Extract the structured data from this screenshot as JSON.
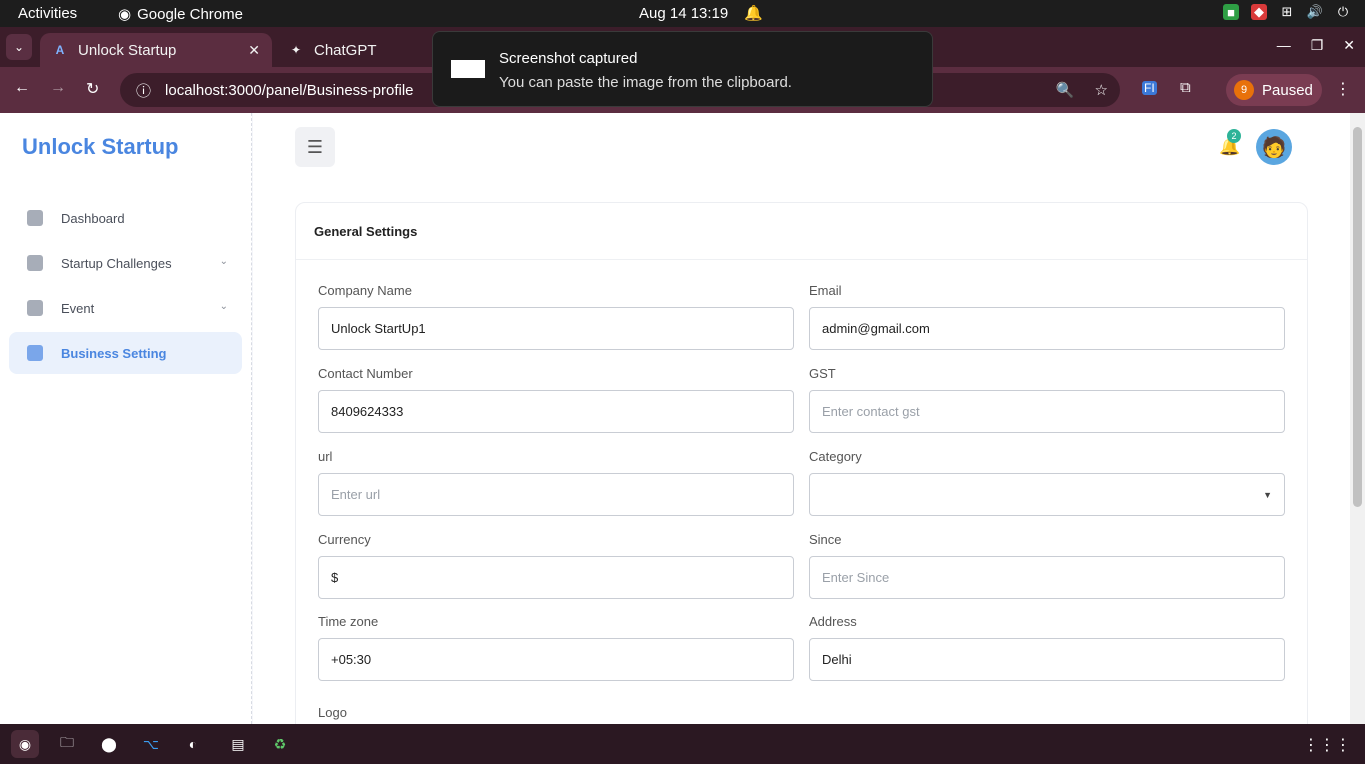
{
  "os": {
    "activities": "Activities",
    "app_name": "Google Chrome",
    "clock": "Aug 14  13:19"
  },
  "browser": {
    "tabs": [
      {
        "label": "Unlock Startup",
        "favicon": "A"
      },
      {
        "label": "ChatGPT",
        "favicon": "✦"
      }
    ],
    "url": "localhost:3000/panel/Business-profile",
    "profile_badge": "9",
    "profile_label": "Paused",
    "ext_label": "FI"
  },
  "toast": {
    "title": "Screenshot captured",
    "message": "You can paste the image from the clipboard."
  },
  "sidebar": {
    "brand": "Unlock Startup",
    "items": [
      {
        "label": "Dashboard"
      },
      {
        "label": "Startup Challenges"
      },
      {
        "label": "Event"
      },
      {
        "label": "Business Setting"
      }
    ]
  },
  "header": {
    "notification_count": "2"
  },
  "form": {
    "title": "General Settings",
    "company_name": {
      "label": "Company Name",
      "value": "Unlock StartUp1"
    },
    "email": {
      "label": "Email",
      "value": "admin@gmail.com"
    },
    "contact": {
      "label": "Contact Number",
      "value": "8409624333"
    },
    "gst": {
      "label": "GST",
      "placeholder": "Enter contact gst"
    },
    "url": {
      "label": "url",
      "placeholder": "Enter url"
    },
    "category": {
      "label": "Category",
      "value": ""
    },
    "currency": {
      "label": "Currency",
      "value": "$"
    },
    "since": {
      "label": "Since",
      "placeholder": "Enter Since"
    },
    "timezone": {
      "label": "Time zone",
      "value": "+05:30"
    },
    "address": {
      "label": "Address",
      "value": "Delhi"
    },
    "logo": {
      "label": "Logo"
    }
  },
  "colors": {
    "accent": "#4a86e0",
    "browser_frame": "#5b2d40",
    "notification_badge": "#2eb398"
  }
}
